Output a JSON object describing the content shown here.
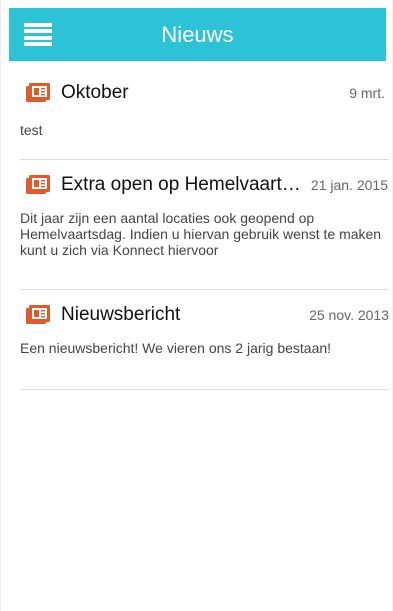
{
  "header": {
    "title": "Nieuws",
    "menu_icon": "menu-icon",
    "color": "#2cc3d6"
  },
  "news_icon": {
    "name": "newspaper-icon",
    "color": "#e05b2b"
  },
  "items": [
    {
      "title": "Oktober",
      "date": "9 mrt.",
      "body": "test"
    },
    {
      "title": "Extra open op Hemelvaartsdag",
      "date": "21 jan. 2015",
      "body": "Dit jaar zijn een aantal locaties ook geopend op Hemelvaartsdag. Indien u hiervan gebruik wenst te maken kunt u zich via Konnect hiervoor"
    },
    {
      "title": "Nieuwsbericht",
      "date": "25 nov. 2013",
      "body": "Een nieuwsbericht! We vieren ons 2 jarig bestaan!"
    }
  ]
}
